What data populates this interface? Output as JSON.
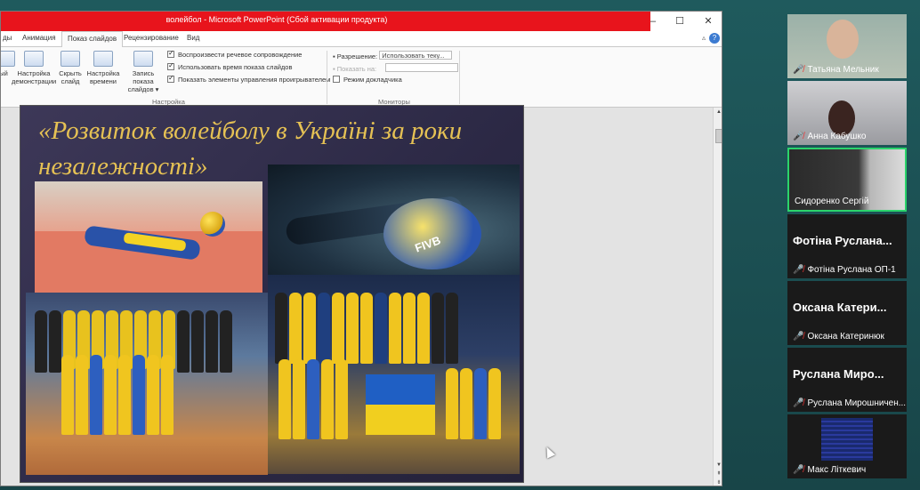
{
  "window": {
    "title": "волейбол - Microsoft PowerPoint (Сбой активации продукта)",
    "controls": {
      "minimize": "–",
      "maximize": "☐",
      "close": "✕"
    }
  },
  "ribbon_tabs": [
    "ды",
    "Анимация",
    "Показ слайдов",
    "Рецензирование",
    "Вид"
  ],
  "ribbon": {
    "buttons": [
      {
        "label": "ый"
      },
      {
        "label": "Настройка демонстрации"
      },
      {
        "label": "Скрыть слайд"
      },
      {
        "label": "Настройка времени"
      },
      {
        "label": "Запись показа слайдов ▾"
      }
    ],
    "checkboxes": [
      {
        "label": "Воспроизвести речевое сопровождение",
        "checked": true
      },
      {
        "label": "Использовать время показа слайдов",
        "checked": true
      },
      {
        "label": "Показать элементы управления проигрывателем",
        "checked": true
      }
    ],
    "group_setup": "Настройка",
    "resolution_label": "Разрешение:",
    "resolution_value": "Использовать теку...",
    "show_on_label": "Показать на:",
    "presenter_view": "Режим докладчика",
    "group_monitors": "Мониторы"
  },
  "slide": {
    "title": "«Розвиток волейболу в Україні за роки незалежності»",
    "photo_text": "FIVB"
  },
  "participants": [
    {
      "name": "Татьяна Мельник",
      "type": "video",
      "muted": true
    },
    {
      "name": "Анна Кабушко",
      "type": "video",
      "muted": true
    },
    {
      "name": "Сидоренко Сергій",
      "type": "video",
      "muted": false,
      "active": true
    },
    {
      "display": "Фотіна Руслана...",
      "name": "Фотіна Руслана ОП-1",
      "muted": true
    },
    {
      "display": "Оксана Катери...",
      "name": "Оксана Катеринюк",
      "muted": true
    },
    {
      "display": "Руслана Миро...",
      "name": "Руслана Мирошничен...",
      "muted": true
    },
    {
      "name": "Макс Літкевич",
      "type": "image",
      "muted": true
    }
  ],
  "colors": {
    "accent_red": "#e8141c",
    "slide_title": "#e5c154",
    "active_speaker": "#2bd46b"
  }
}
